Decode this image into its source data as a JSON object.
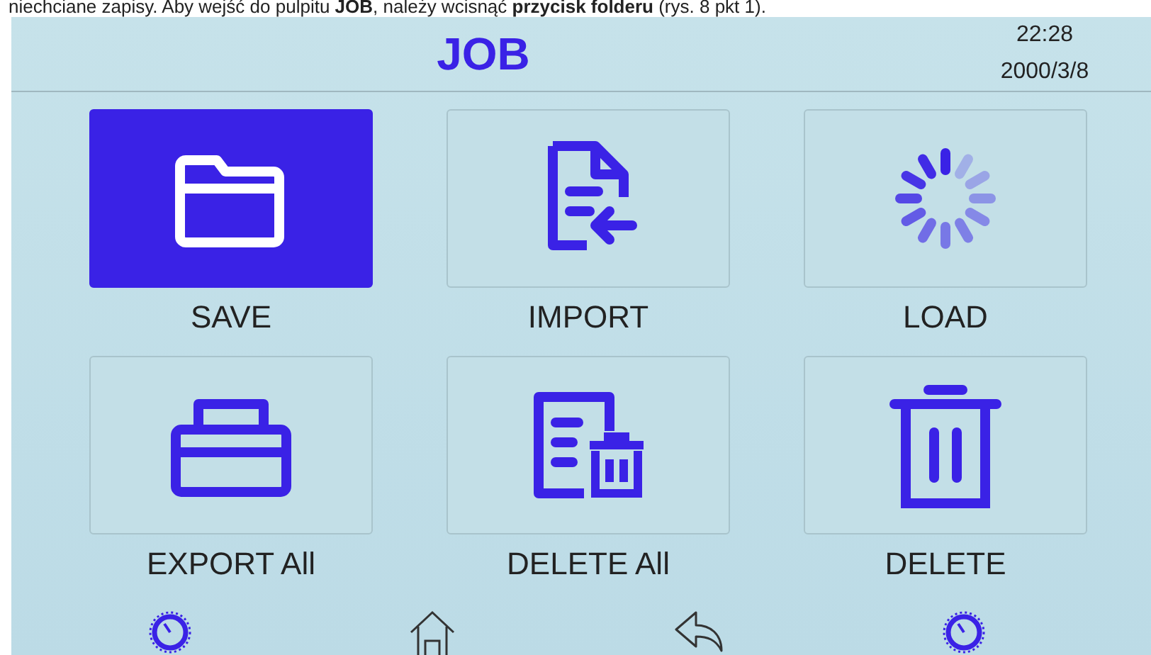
{
  "caption": "niechciane zapisy. Aby wejść do pulpitu **JOB**, należy wcisnąć **przycisk folderu** (rys. 8 pkt 1).",
  "header": {
    "title": "JOB",
    "time": "22:28",
    "date": "2000/3/8"
  },
  "tiles": [
    {
      "kind": "folder",
      "label": "SAVE",
      "selected": true
    },
    {
      "kind": "import",
      "label": "IMPORT",
      "selected": false
    },
    {
      "kind": "spinner",
      "label": "LOAD",
      "selected": false
    },
    {
      "kind": "printer",
      "label": "EXPORT All",
      "selected": false
    },
    {
      "kind": "delete-all",
      "label": "DELETE All",
      "selected": false
    },
    {
      "kind": "trash",
      "label": "DELETE",
      "selected": false
    }
  ],
  "bottom_bar": [
    {
      "kind": "dial"
    },
    {
      "kind": "home"
    },
    {
      "kind": "back"
    },
    {
      "kind": "dial"
    }
  ]
}
